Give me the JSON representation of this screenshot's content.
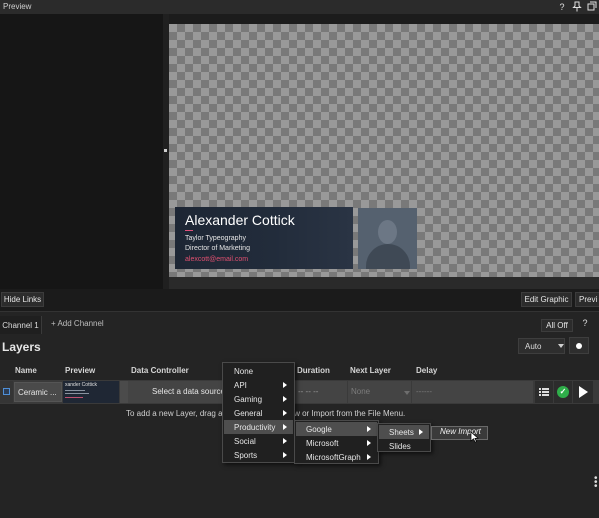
{
  "preview_header": {
    "title": "Preview",
    "icons": [
      "help-icon",
      "pin-icon",
      "popout-icon"
    ],
    "help_glyph": "?"
  },
  "lower_third": {
    "name": "Alexander Cottick",
    "company": "Taylor Typeography",
    "role": "Director of Marketing",
    "email": "alexcott@email.com"
  },
  "toolbar": {
    "hide_links": "Hide Links",
    "edit_graphic": "Edit Graphic",
    "preview": "Previ"
  },
  "channels": {
    "tab": "Channel 1",
    "add": "+ Add Channel",
    "all_off": "All Off",
    "help": "?"
  },
  "layers": {
    "title": "Layers",
    "mode": "Auto",
    "columns": {
      "name": "Name",
      "preview": "Preview",
      "data_controller": "Data Controller",
      "duration": "Duration",
      "next_layer": "Next Layer",
      "delay": "Delay"
    },
    "row": {
      "name": "Ceramic ...",
      "thumb_name": "xander Cottick",
      "data_controller": "Select a data source",
      "duration": "-- -- --",
      "next_layer": "None",
      "delay": "------"
    },
    "hint": "To add a new Layer, drag a G                                    ory or choose New or Import from the File Menu.",
    "check_glyph": "✓"
  },
  "menus": {
    "data_source": [
      {
        "label": "None",
        "submenu": false
      },
      {
        "label": "API",
        "submenu": true
      },
      {
        "label": "Gaming",
        "submenu": true
      },
      {
        "label": "General",
        "submenu": true
      },
      {
        "label": "Productivity",
        "submenu": true,
        "highlighted": true
      },
      {
        "label": "Social",
        "submenu": true
      },
      {
        "label": "Sports",
        "submenu": true
      }
    ],
    "productivity": [
      {
        "label": "Google",
        "submenu": true,
        "highlighted": true
      },
      {
        "label": "Microsoft",
        "submenu": true
      },
      {
        "label": "MicrosoftGraph",
        "submenu": true
      }
    ],
    "google": [
      {
        "label": "Sheets",
        "submenu": true,
        "highlighted": true
      },
      {
        "label": "Slides",
        "submenu": false
      }
    ],
    "sheets": {
      "label": "New Import"
    }
  }
}
